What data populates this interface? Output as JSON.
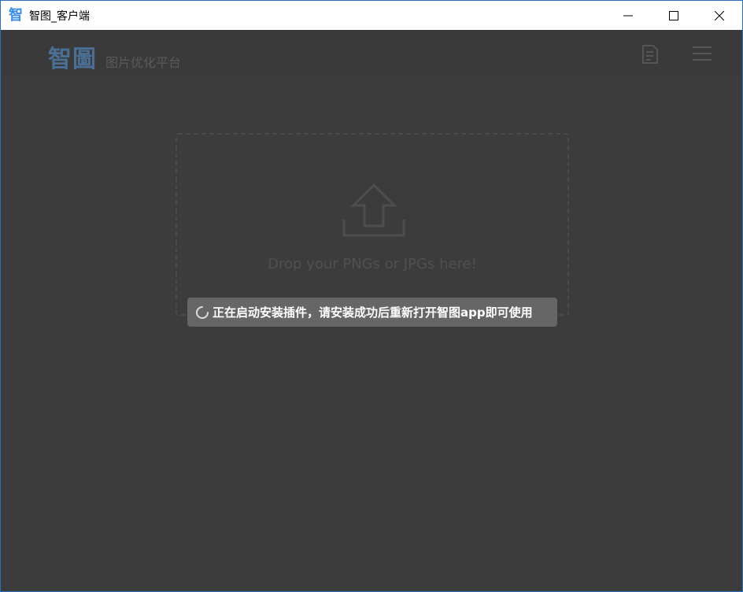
{
  "window": {
    "title": "智图_客户端",
    "app_icon_glyph": "智",
    "controls": [
      "minimize-icon",
      "maximize-icon",
      "close-icon"
    ]
  },
  "header": {
    "logo": "智圖",
    "subtitle": "图片优化平台",
    "icons": [
      "document-icon",
      "menu-icon"
    ]
  },
  "dropzone": {
    "text": "Drop your PNGs or JPGs here!",
    "icon": "upload-icon"
  },
  "toast": {
    "message": "正在启动安装插件，请安装成功后重新打开智图app即可使用",
    "icon": "spinner-icon"
  },
  "colors": {
    "accent": "#3a8ee6",
    "background": "#3c3c3c",
    "toast": "#666666"
  }
}
